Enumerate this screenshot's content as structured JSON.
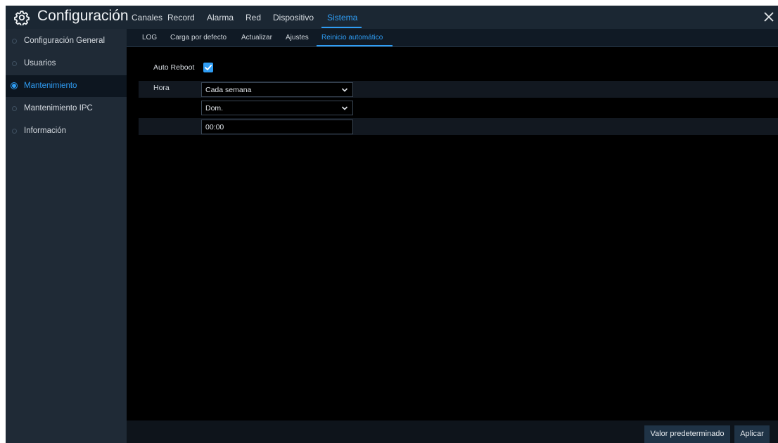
{
  "app": {
    "title": "Configuración"
  },
  "main_tabs": [
    {
      "label": "Canales"
    },
    {
      "label": "Record"
    },
    {
      "label": "Alarma"
    },
    {
      "label": "Red"
    },
    {
      "label": "Dispositivo"
    },
    {
      "label": "Sistema",
      "active": true
    }
  ],
  "sidebar": {
    "items": [
      {
        "label": "Configuración General"
      },
      {
        "label": "Usuarios"
      },
      {
        "label": "Mantenimiento",
        "active": true
      },
      {
        "label": "Mantenimiento IPC"
      },
      {
        "label": "Información"
      }
    ]
  },
  "sub_tabs": [
    {
      "label": "LOG"
    },
    {
      "label": "Carga por defecto"
    },
    {
      "label": "Actualizar"
    },
    {
      "label": "Ajustes"
    },
    {
      "label": "Reinicio automático",
      "active": true
    }
  ],
  "form": {
    "auto_reboot_label": "Auto Reboot",
    "auto_reboot_checked": true,
    "hora_label": "Hora",
    "frequency_value": "Cada semana",
    "day_value": "Dom.",
    "time_value": "00:00"
  },
  "footer": {
    "default_button": "Valor predeterminado",
    "apply_button": "Aplicar"
  },
  "colors": {
    "accent": "#2f9df4",
    "topbar": "#1b2733",
    "sidebar": "#1f2a36",
    "background": "#000000"
  },
  "icons": {
    "brand": "gear-icon",
    "close": "close-icon",
    "dropdown": "chevron-down-icon",
    "check": "check-icon"
  }
}
